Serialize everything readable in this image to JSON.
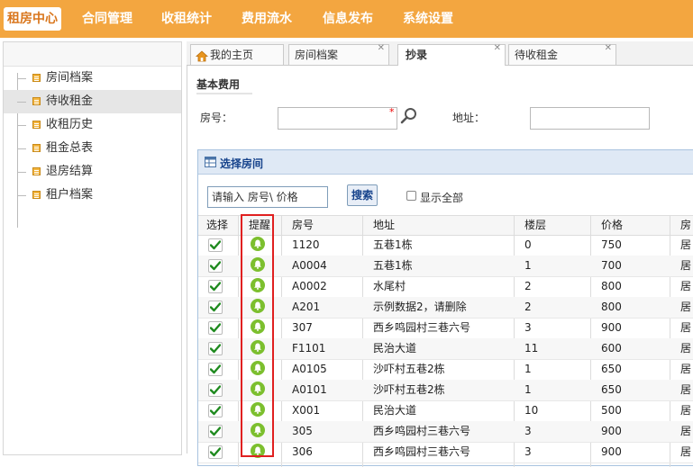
{
  "nav": {
    "items": [
      "租房中心",
      "合同管理",
      "收租统计",
      "费用流水",
      "信息发布",
      "系统设置"
    ],
    "active": "租房中心"
  },
  "sidebar": {
    "items": [
      {
        "label": "房间档案",
        "selected": false
      },
      {
        "label": "待收租金",
        "selected": true
      },
      {
        "label": "收租历史",
        "selected": false
      },
      {
        "label": "租金总表",
        "selected": false
      },
      {
        "label": "退房结算",
        "selected": false
      },
      {
        "label": "租户档案",
        "selected": false
      }
    ],
    "icon": "document-icon"
  },
  "tabs": [
    {
      "label": "我的主页",
      "icon": "home-icon",
      "closable": false,
      "active": false
    },
    {
      "label": "房间档案",
      "closable": true,
      "active": false
    },
    {
      "label": "抄录",
      "closable": true,
      "active": true
    },
    {
      "label": "待收租金",
      "closable": true,
      "active": false
    }
  ],
  "form": {
    "section_title": "基本费用",
    "room_label": "房号：",
    "room_value": "",
    "required_mark": "*",
    "address_label": "地址：",
    "address_value": ""
  },
  "dialog": {
    "title": "选择房间",
    "search_value": "请输入 房号\\ 价格",
    "search_button": "搜索",
    "show_all_label": "显示全部",
    "show_all_checked": false
  },
  "table": {
    "columns": [
      "选择",
      "提醒",
      "房号",
      "地址",
      "楼层",
      "价格",
      "房"
    ],
    "rows": [
      {
        "room": "1120",
        "address": "五巷1栋",
        "floor": "0",
        "price": "750",
        "type": "居"
      },
      {
        "room": "A0004",
        "address": "五巷1栋",
        "floor": "1",
        "price": "700",
        "type": "居"
      },
      {
        "room": "A0002",
        "address": "水尾村",
        "floor": "2",
        "price": "800",
        "type": "居"
      },
      {
        "room": "A201",
        "address": "示例数据2，请删除",
        "floor": "2",
        "price": "800",
        "type": "居"
      },
      {
        "room": "307",
        "address": "西乡鸣园村三巷六号",
        "floor": "3",
        "price": "900",
        "type": "居"
      },
      {
        "room": "F1101",
        "address": "民治大道",
        "floor": "11",
        "price": "600",
        "type": "居"
      },
      {
        "room": "A0105",
        "address": "沙吓村五巷2栋",
        "floor": "1",
        "price": "650",
        "type": "居"
      },
      {
        "room": "A0101",
        "address": "沙吓村五巷2栋",
        "floor": "1",
        "price": "650",
        "type": "居"
      },
      {
        "room": "X001",
        "address": "民治大道",
        "floor": "10",
        "price": "500",
        "type": "居"
      },
      {
        "room": "305",
        "address": "西乡鸣园村三巷六号",
        "floor": "3",
        "price": "900",
        "type": "居"
      },
      {
        "room": "306",
        "address": "西乡鸣园村三巷六号",
        "floor": "3",
        "price": "900",
        "type": "居"
      }
    ]
  },
  "colors": {
    "nav_bg": "#f3a640",
    "highlight_border": "#e02020",
    "reminder_icon": "#7cbf2e",
    "check_icon": "#1f8a1f"
  }
}
